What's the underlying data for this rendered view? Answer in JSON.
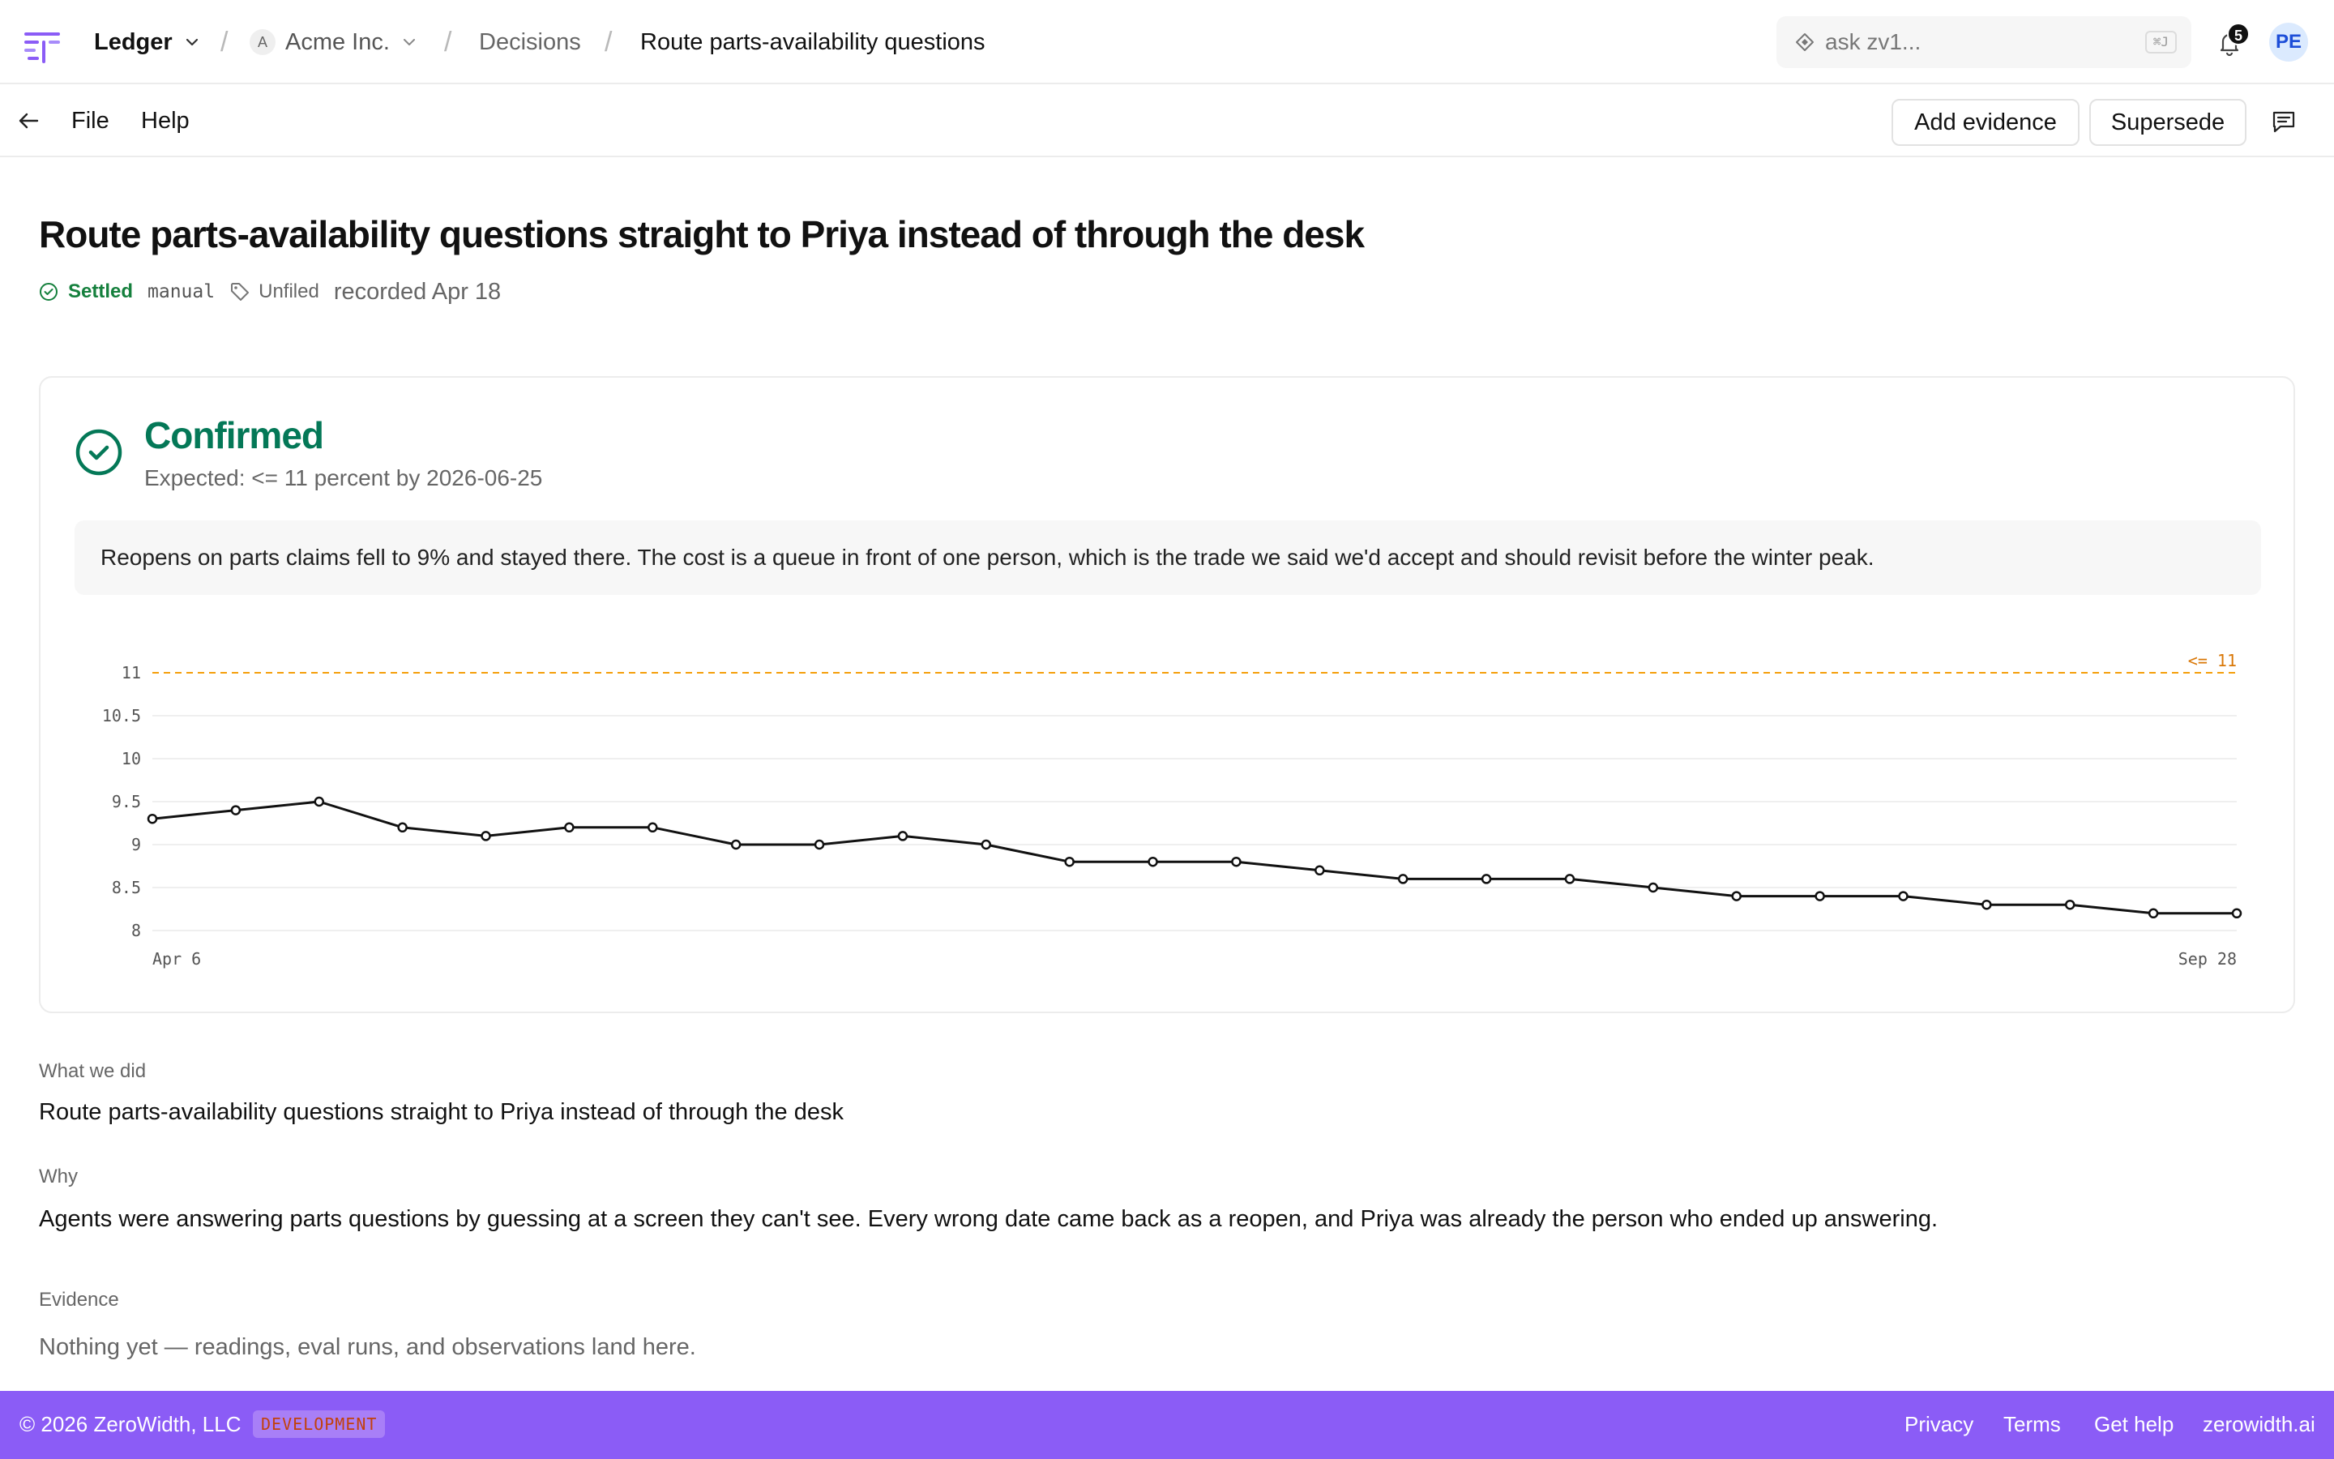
{
  "topbar": {
    "app_name": "Ledger",
    "org_initial": "A",
    "org_name": "Acme Inc.",
    "section": "Decisions",
    "current": "Route parts-availability questions straight to Priya instead of through the desk",
    "search_placeholder": "ask zv1...",
    "search_shortcut": "⌘J",
    "notification_count": "5",
    "user_initials": "PE"
  },
  "subbar": {
    "menu": [
      "File",
      "Help"
    ],
    "add_evidence_label": "Add evidence",
    "supersede_label": "Supersede"
  },
  "decision": {
    "title": "Route parts-availability questions straight to Priya instead of through the desk",
    "status": "Settled",
    "source": "manual",
    "tag": "Unfiled",
    "recorded": "recorded Apr 18"
  },
  "outcome": {
    "title": "Confirmed",
    "expected": "Expected: <= 11 percent  by 2026-06-25",
    "note": "Reopens on parts claims fell to 9% and stayed there. The cost is a queue in front of one person, which is the trade we said we'd accept and should revisit before the winter peak."
  },
  "chart_data": {
    "type": "line",
    "x_start_label": "Apr 6",
    "x_end_label": "Sep 28",
    "values": [
      9.3,
      9.4,
      9.5,
      9.2,
      9.1,
      9.2,
      9.2,
      9.0,
      9.0,
      9.1,
      9.0,
      8.8,
      8.8,
      8.8,
      8.7,
      8.6,
      8.6,
      8.6,
      8.5,
      8.4,
      8.4,
      8.4,
      8.3,
      8.3,
      8.2,
      8.2
    ],
    "y_ticks": [
      "11",
      "10.5",
      "10",
      "9.5",
      "9",
      "8.5",
      "8"
    ],
    "ylim": [
      8,
      11
    ],
    "threshold": 11,
    "threshold_label": "<= 11",
    "threshold_color": "#f59e0b",
    "line_color": "#111111",
    "grid": true
  },
  "sections": {
    "what_label": "What we did",
    "what_text": "Route parts-availability questions straight to Priya instead of through the desk",
    "why_label": "Why",
    "why_text": "Agents were answering parts questions by guessing at a screen they can't see. Every wrong date came back as a reopen, and Priya was already the person who ended up answering.",
    "evidence_label": "Evidence",
    "evidence_text": "Nothing yet — readings, eval runs, and observations land here."
  },
  "footer": {
    "copyright": "© 2026 ZeroWidth, LLC",
    "env_tag": "DEVELOPMENT",
    "links": [
      "Privacy",
      "Terms",
      "Get help",
      "zerowidth.ai"
    ]
  },
  "colors": {
    "accent": "#8b5cf6",
    "confirmed": "#047857",
    "settled": "#15803d"
  }
}
